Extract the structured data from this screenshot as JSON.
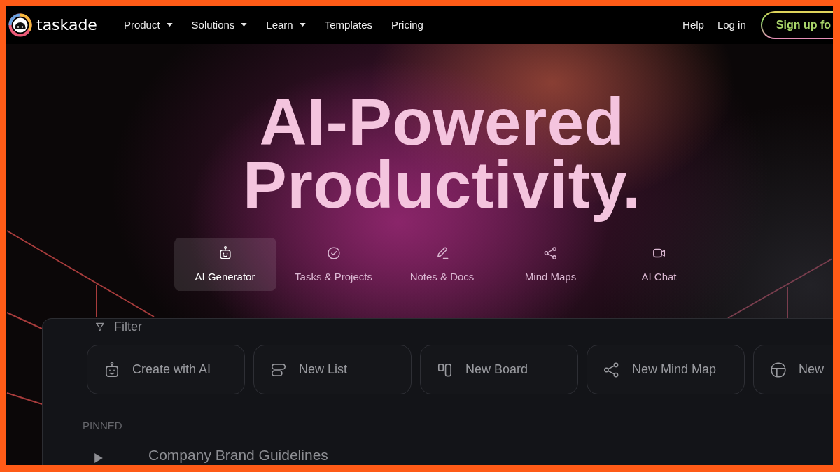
{
  "brand": {
    "name": "taskade"
  },
  "nav": {
    "items": [
      {
        "label": "Product",
        "has_menu": true
      },
      {
        "label": "Solutions",
        "has_menu": true
      },
      {
        "label": "Learn",
        "has_menu": true
      },
      {
        "label": "Templates",
        "has_menu": false
      },
      {
        "label": "Pricing",
        "has_menu": false
      }
    ],
    "right_links": [
      "Help",
      "Log in"
    ],
    "signup_button": "Sign up fo"
  },
  "hero": {
    "title_lines": [
      "AI-Powered",
      "Productivity."
    ]
  },
  "feature_tabs": [
    {
      "label": "AI Generator",
      "selected": true
    },
    {
      "label": "Tasks & Projects",
      "selected": false
    },
    {
      "label": "Notes & Docs",
      "selected": false
    },
    {
      "label": "Mind Maps",
      "selected": false
    },
    {
      "label": "AI Chat",
      "selected": false
    }
  ],
  "panel": {
    "filter_label": "Filter",
    "create_buttons": [
      "Create with AI",
      "New List",
      "New Board",
      "New Mind Map",
      "New"
    ],
    "section_label": "PINNED",
    "pinned_items": [
      {
        "title": "Company Brand Guidelines",
        "expanded": false
      }
    ]
  }
}
